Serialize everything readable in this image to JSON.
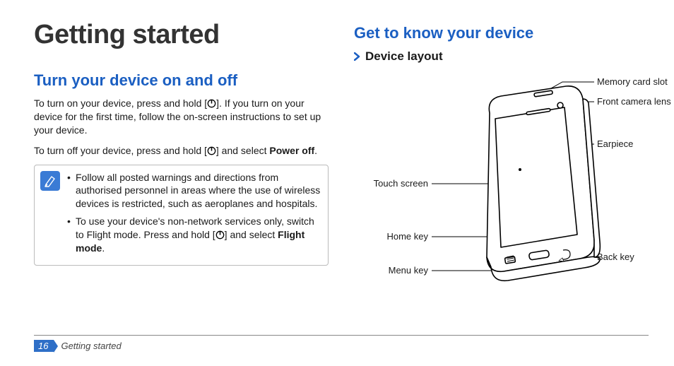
{
  "chapter_title": "Getting started",
  "left": {
    "section_title": "Turn your device on and off",
    "p1_a": "To turn on your device, press and hold [",
    "p1_b": "]. If you turn on your device for the first time, follow the on-screen instructions to set up your device.",
    "p2_a": "To turn off your device, press and hold [",
    "p2_b": "] and select ",
    "p2_bold": "Power off",
    "p2_c": ".",
    "note1": "Follow all posted warnings and directions from authorised personnel in areas where the use of wireless devices is restricted, such as aeroplanes and hospitals.",
    "note2_a": "To use your device's non-network services only, switch to Flight mode. Press and hold [",
    "note2_b": "] and select ",
    "note2_bold": "Flight mode",
    "note2_c": "."
  },
  "right": {
    "section_title": "Get to know your device",
    "sub_title": "Device layout",
    "labels": {
      "memory_card_slot": "Memory card slot",
      "front_camera_lens": "Front camera lens",
      "earpiece": "Earpiece",
      "touch_screen": "Touch screen",
      "home_key": "Home key",
      "menu_key": "Menu key",
      "back_key": "Back key"
    }
  },
  "footer": {
    "page_number": "16",
    "section": "Getting started"
  }
}
